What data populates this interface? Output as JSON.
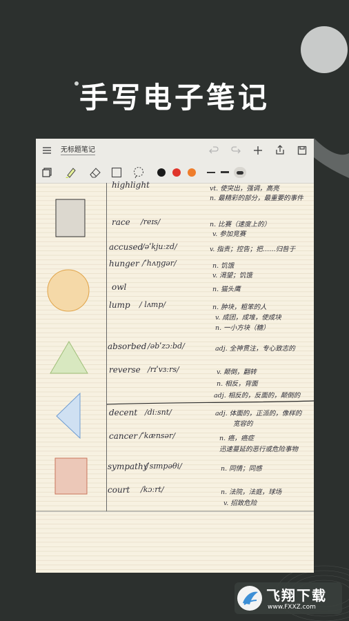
{
  "headline": "手写电子笔记",
  "app": {
    "doc_title": "无标题笔记",
    "title_icons": [
      "menu-icon",
      "undo-icon",
      "redo-icon",
      "plus-icon",
      "share-icon",
      "save-icon"
    ],
    "tool_icons": [
      "pages-icon",
      "highlighter-icon",
      "eraser-icon",
      "shape-icon",
      "lasso-icon"
    ],
    "pen_colors": [
      "#1a1a1a",
      "#e0352b",
      "#ef7d2b"
    ]
  },
  "shapes": {
    "rectangle_fill": "#dcd8cf",
    "circle_fill": "#f5d9a8",
    "triangle_fill": "#d8e8c0",
    "left_triangle_fill": "#cfe0f2",
    "square_fill": "#ecc8b8"
  },
  "notes": [
    {
      "word": "highlight",
      "ipa": "",
      "def": [
        "vt. 使突出，强调，高亮",
        "n. 最精彩的部分，最重要的事件"
      ]
    },
    {
      "word": "race",
      "ipa": "/reɪs/",
      "def": [
        "n. 比赛（速度上的）",
        "v. 参加竞赛"
      ]
    },
    {
      "word": "accused",
      "ipa": "/əˈkjuːzd/",
      "def": [
        "v. 指责；控告；把……归咎于"
      ]
    },
    {
      "word": "hunger",
      "ipa": "/ˈhʌŋɡər/",
      "def": [
        "n. 饥饿",
        "v. 渴望；饥饿"
      ]
    },
    {
      "word": "owl",
      "ipa": "",
      "def": [
        "n. 猫头鹰"
      ]
    },
    {
      "word": "lump",
      "ipa": "/ lʌmp/",
      "def": [
        "n. 肿块，粗笨的人",
        "v. 成团，成堆，使成块",
        "n. 一小方块（糖）"
      ]
    },
    {
      "word": "absorbed",
      "ipa": "/əbˈzɔːbd/",
      "def": [
        "adj. 全神贯注，专心致志的"
      ]
    },
    {
      "word": "reverse",
      "ipa": "/rɪˈvɜːrs/",
      "def": [
        "v. 颠倒，翻转",
        "n. 相反，背面",
        "adj. 相反的，反面的，颠倒的"
      ]
    },
    {
      "word": "decent",
      "ipa": "/diːsnt/",
      "def": [
        "adj. 体面的，正派的，像样的",
        "宽容的"
      ]
    },
    {
      "word": "cancer",
      "ipa": "/ˈkænsər/",
      "def": [
        "n. 癌，癌症",
        "迅速蔓延的恶行或危险事物"
      ]
    },
    {
      "word": "sympathy",
      "ipa": "/ˈsɪmpəθi/",
      "def": [
        "n. 同情；同感"
      ]
    },
    {
      "word": "court",
      "ipa": "/kɔːrt/",
      "def": [
        "n. 法院，法庭，球场",
        "v. 招致危险"
      ]
    }
  ],
  "watermark": {
    "brand": "飞翔下载",
    "url": "www.FXXZ.com"
  }
}
